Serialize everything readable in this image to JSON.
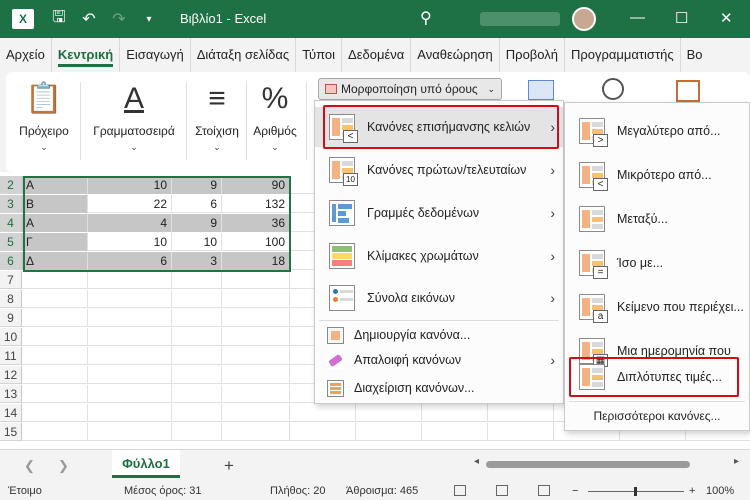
{
  "titlebar": {
    "title": "Βιβλίο1 - Excel",
    "icons": [
      "excel-logo",
      "save-icon",
      "undo-icon",
      "redo-icon",
      "customize-icon",
      "search-icon",
      "minimize-icon",
      "maximize-icon",
      "close-icon"
    ],
    "accent": "#1e7145"
  },
  "tabs": [
    "Αρχείο",
    "Κεντρική",
    "Εισαγωγή",
    "Διάταξη σελίδας",
    "Τύποι",
    "Δεδομένα",
    "Αναθεώρηση",
    "Προβολή",
    "Προγραμματιστής",
    "Βο"
  ],
  "ribbon": {
    "clipboard": "Πρόχειρο",
    "font": "Γραμματοσειρά",
    "alignment": "Στοίχιση",
    "number": "Αριθμός",
    "cf_button": "Μορφοποίηση υπό όρους"
  },
  "rows": [
    {
      "num": "2",
      "a": "A",
      "b": "10",
      "c": "9",
      "d": "90"
    },
    {
      "num": "3",
      "a": "B",
      "b": "22",
      "c": "6",
      "d": "132"
    },
    {
      "num": "4",
      "a": "A",
      "b": "4",
      "c": "9",
      "d": "36"
    },
    {
      "num": "5",
      "a": "Γ",
      "b": "10",
      "c": "10",
      "d": "100"
    },
    {
      "num": "6",
      "a": "Δ",
      "b": "6",
      "c": "3",
      "d": "18"
    }
  ],
  "empty_rows": [
    "7",
    "8",
    "9",
    "10",
    "11",
    "12",
    "13",
    "14",
    "15"
  ],
  "menu1": {
    "highlight": "Κανόνες επισήμανσης κελιών",
    "topbottom": "Κανόνες πρώτων/τελευταίων",
    "databars": "Γραμμές δεδομένων",
    "scales": "Κλίμακες χρωμάτων",
    "iconsets": "Σύνολα εικόνων",
    "newrule": "Δημιουργία κανόνα...",
    "clear": "Απαλοιφή κανόνων",
    "manage": "Διαχείριση κανόνων..."
  },
  "menu2": {
    "greater": "Μεγαλύτερο από...",
    "less": "Μικρότερο από...",
    "between": "Μεταξύ...",
    "equal": "Ίσο με...",
    "text": "Κείμενο που περιέχει...",
    "date": "Μια ημερομηνία που",
    "duplicates": "Διπλότυπες τιμές...",
    "more": "Περισσότεροι κανόνες..."
  },
  "sheet_tab": "Φύλλο1",
  "status": {
    "ready": "Έτοιμο",
    "average": "Μέσος όρος: 31",
    "count": "Πλήθος: 20",
    "sum": "Άθροισμα: 465",
    "zoom": "100%"
  }
}
